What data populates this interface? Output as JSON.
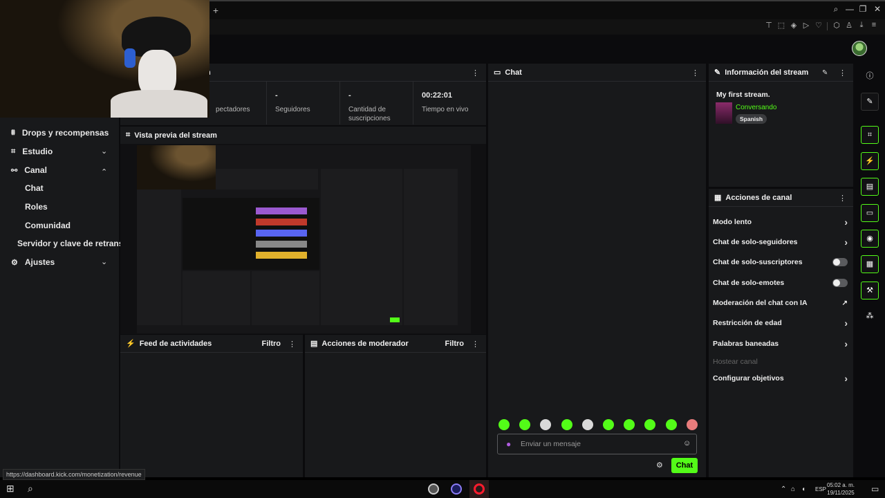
{
  "browser": {
    "new_tab": "+",
    "window_controls": [
      "search-icon",
      "minimize-icon",
      "restore-icon",
      "close-icon"
    ],
    "toolbar_icons": [
      "pin-icon",
      "screenshot-icon",
      "shield-icon",
      "play-icon",
      "heart-icon",
      "extensions-icon",
      "profile-icon",
      "download-icon",
      "menu-icon",
      "more-icon"
    ]
  },
  "sidebar": {
    "items": [
      {
        "label": "Drops y recompensas",
        "icon": "drops-icon"
      },
      {
        "label": "Estudio",
        "icon": "studio-icon",
        "chevron": "⌄"
      },
      {
        "label": "Canal",
        "icon": "channel-icon",
        "chevron": "⌃"
      },
      {
        "label": "Ajustes",
        "icon": "gear-icon",
        "chevron": "⌄"
      }
    ],
    "sub_items": [
      "Chat",
      "Roles",
      "Comunidad"
    ],
    "server_item": "Servidor y clave de retrans"
  },
  "stats": {
    "title_fragment": "n",
    "items": [
      {
        "value": "",
        "label": "pectadores"
      },
      {
        "value": "-",
        "label": "Seguidores"
      },
      {
        "value": "-",
        "label": "Cantidad de suscripciones"
      },
      {
        "value": "00:22:01",
        "label": "Tiempo en vivo"
      }
    ]
  },
  "preview": {
    "title": "Vista previa del stream"
  },
  "feed": {
    "title": "Feed de actividades",
    "filter": "Filtro"
  },
  "mod_actions": {
    "title": "Acciones de moderador",
    "filter": "Filtro"
  },
  "chat": {
    "title": "Chat",
    "placeholder": "Enviar un mensaje",
    "send_label": "Chat",
    "emote_count": 10
  },
  "info": {
    "title": "Información del stream",
    "stream_title": "My first stream.",
    "category": "Conversando",
    "language": "Spanish"
  },
  "actions": {
    "title": "Acciones de canal",
    "rows": [
      {
        "label": "Modo lento",
        "control": "chevron"
      },
      {
        "label": "Chat de solo-seguidores",
        "control": "chevron"
      },
      {
        "label": "Chat de solo-suscriptores",
        "control": "toggle",
        "on": false
      },
      {
        "label": "Chat de solo-emotes",
        "control": "toggle",
        "on": false
      },
      {
        "label": "Moderación del chat con IA",
        "control": "external"
      },
      {
        "label": "Restricción de edad",
        "control": "chevron"
      },
      {
        "label": "Palabras baneadas",
        "control": "chevron"
      },
      {
        "label": "Hostear canal",
        "control": "none",
        "disabled": true
      },
      {
        "label": "Configurar objetivos",
        "control": "chevron"
      }
    ]
  },
  "rail": [
    "info-icon",
    "edit-icon",
    "scan-icon",
    "bolt-icon",
    "notes-icon",
    "chat-bubble-icon",
    "broadcast-icon",
    "layout-icon",
    "wrench-icon",
    "more-tools-icon"
  ],
  "status_url": "https://dashboard.kick.com/monetization/revenue",
  "taskbar": {
    "language": "ESP",
    "time": "05:02 a. m.",
    "date": "19/11/2025"
  },
  "colors": {
    "accent": "#53fc18",
    "panel": "#18191b",
    "background": "#0b0b0d"
  }
}
